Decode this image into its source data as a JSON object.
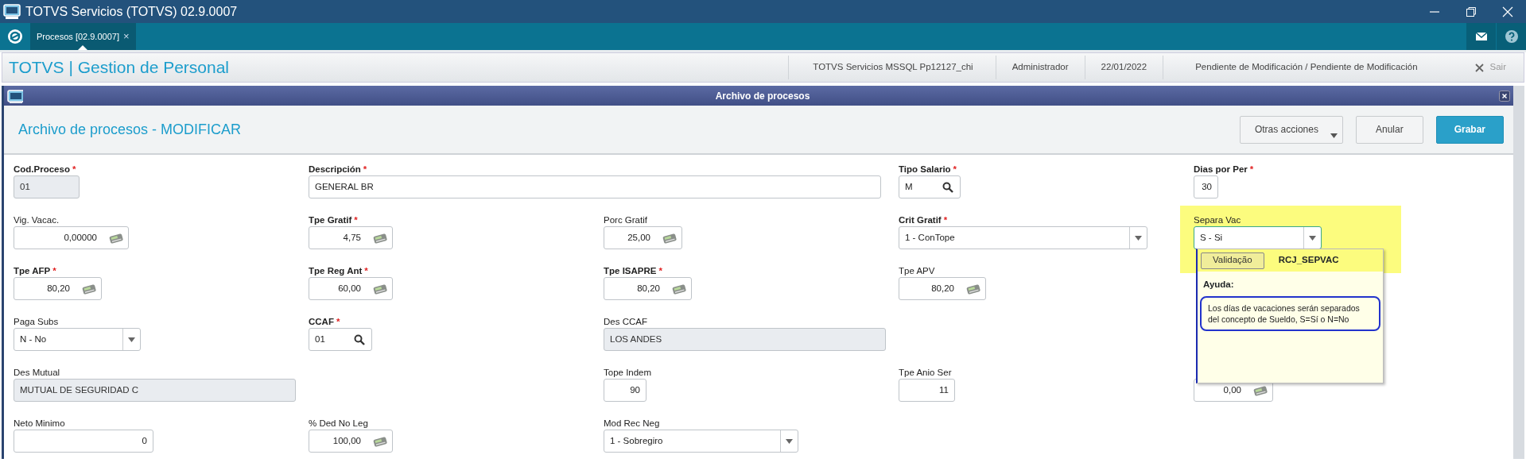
{
  "app_title": "TOTVS Servicios (TOTVS) 02.9.0007",
  "tabs": [
    {
      "label": "Procesos [02.9.0007]",
      "selected": true,
      "close": "×"
    }
  ],
  "header": {
    "title": "TOTVS | Gestion de Personal",
    "info": [
      "TOTVS Servicios MSSQL Pp12127_chi",
      "Administrador",
      "22/01/2022",
      "Pendiente de Modificación / Pendiente de Modificación"
    ],
    "exit": "Sair"
  },
  "dialog": {
    "title": "Archivo de procesos",
    "heading": "Archivo de procesos - MODIFICAR",
    "buttons": [
      {
        "label": "Otras acciones",
        "kind": "dropdown"
      },
      {
        "label": "Anular",
        "kind": "default"
      },
      {
        "label": "Grabar",
        "kind": "primary"
      }
    ]
  },
  "form_rows": [
    [
      {
        "label": "Cod.Proceso",
        "required_mark": "*",
        "kind": "readonly",
        "value": "01"
      },
      {
        "label": "Descripción",
        "required_mark": "*",
        "kind": "text",
        "value": "GENERAL BR"
      },
      null,
      {
        "label": "Tipo Salario",
        "required_mark": "*",
        "kind": "lookup",
        "value": "M"
      },
      {
        "label": "Dias por Per",
        "required_mark": "*",
        "kind": "number",
        "value": "30"
      }
    ],
    [
      {
        "label": "Vig. Vacac.",
        "kind": "calc",
        "value": "0,00000"
      },
      {
        "label": "Tpe Gratif",
        "required_mark": "*",
        "kind": "calc",
        "value": "4,75"
      },
      {
        "label": "Porc Gratif",
        "kind": "calc",
        "value": "25,00"
      },
      {
        "label": "Crit Gratif",
        "required_mark": "*",
        "kind": "select",
        "value": "1 - ConTope"
      },
      {
        "label": "Separa Vac",
        "kind": "select",
        "value": "S - Si",
        "highlighted": true
      }
    ],
    [
      {
        "label": "Tpe AFP",
        "required_mark": "*",
        "kind": "calc",
        "value": "80,20"
      },
      {
        "label": "Tpe Reg Ant",
        "required_mark": "*",
        "kind": "calc",
        "value": "60,00"
      },
      {
        "label": "Tpe ISAPRE",
        "required_mark": "*",
        "kind": "calc",
        "value": "80,20"
      },
      {
        "label": "Tpe APV",
        "kind": "calc",
        "value": "80,20"
      },
      null
    ],
    [
      {
        "label": "Paga Subs",
        "kind": "select",
        "value": "N - No"
      },
      {
        "label": "CCAF",
        "required_mark": "*",
        "kind": "lookup",
        "value": "01"
      },
      {
        "label": "Des CCAF",
        "kind": "readonly",
        "value": "LOS ANDES"
      },
      null,
      null
    ],
    [
      {
        "label": "Des Mutual",
        "kind": "readonly",
        "value": "MUTUAL DE SEGURIDAD C"
      },
      null,
      {
        "label": "Tope Indem",
        "kind": "number",
        "value": "90"
      },
      {
        "label": "Tpe Anio Ser",
        "kind": "number",
        "value": "11"
      },
      {
        "kind": "calc",
        "value": "0,00"
      }
    ],
    [
      {
        "label": "Neto Minimo",
        "kind": "number",
        "value": "0"
      },
      {
        "label": "% Ded No Leg",
        "kind": "calc",
        "value": "100,00"
      },
      {
        "label": "Mod Rec Neg",
        "kind": "select",
        "value": "1 - Sobregiro"
      },
      null,
      null
    ]
  ],
  "help_popup": {
    "button": "Validação",
    "field_id": "RCJ_SEPVAC",
    "heading": "Ayuda:",
    "text_lines": [
      "Los días de vacaciones serán separados",
      "del concepto de Sueldo, S=Sí o N=No"
    ]
  }
}
